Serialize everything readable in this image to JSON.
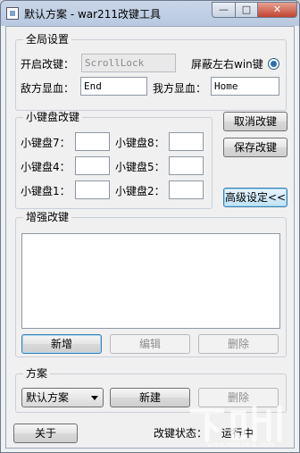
{
  "window": {
    "title": "默认方案 - war211改键工具",
    "min_glyph": "—",
    "max_glyph": "□",
    "close_glyph": "✕"
  },
  "global": {
    "group_label": "全局设置",
    "enable_label": "开启改键：",
    "enable_value": "ScrollLock",
    "block_win_label": "屏蔽左右win键",
    "enemy_hp_label": "敌方显血：",
    "enemy_hp_value": "End",
    "ally_hp_label": "我方显血：",
    "ally_hp_value": "Home"
  },
  "numpad": {
    "group_label": "小键盘改键",
    "k7": "小键盘7：",
    "k8": "小键盘8：",
    "k4": "小键盘4：",
    "k5": "小键盘5：",
    "k1": "小键盘1：",
    "k2": "小键盘2：",
    "v7": "",
    "v8": "",
    "v4": "",
    "v5": "",
    "v1": "",
    "v2": ""
  },
  "side": {
    "cancel": "取消改键",
    "save": "保存改键",
    "advanced": "高级设定<<"
  },
  "enhanced": {
    "group_label": "增强改键",
    "add": "新增",
    "edit": "编辑",
    "delete": "删除"
  },
  "scheme": {
    "group_label": "方案",
    "selected": "默认方案",
    "new": "新建",
    "delete": "删除"
  },
  "footer": {
    "about": "关于",
    "status_label": "改键状态：",
    "status_value": "运行中"
  },
  "watermark": {
    "text": "下载吧",
    "url": "www.xiazaiba.com"
  }
}
